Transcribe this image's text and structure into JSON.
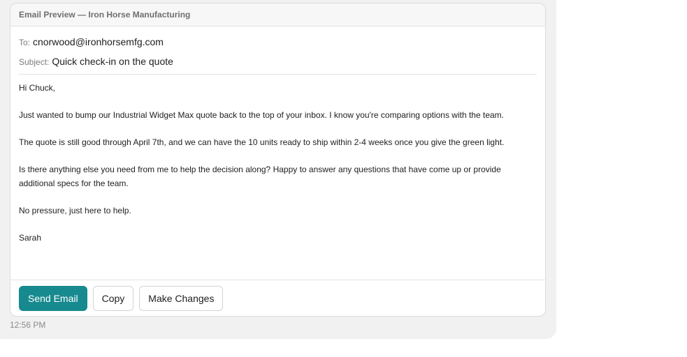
{
  "card": {
    "title": "Email Preview — Iron Horse Manufacturing"
  },
  "email": {
    "to_label": "To:",
    "to": "cnorwood@ironhorsemfg.com",
    "subject_label": "Subject:",
    "subject": "Quick check-in on the quote",
    "paragraphs": [
      "Hi Chuck,",
      "Just wanted to bump our Industrial Widget Max quote back to the top of your inbox. I know you're comparing options with the team.",
      "The quote is still good through April 7th, and we can have the 10 units ready to ship within 2-4 weeks once you give the green light.",
      "Is there anything else you need from me to help the decision along? Happy to answer any questions that have come up or provide additional specs for the team.",
      "No pressure, just here to help.",
      "Sarah"
    ]
  },
  "actions": {
    "send": "Send Email",
    "copy": "Copy",
    "changes": "Make Changes"
  },
  "message": {
    "timestamp": "12:56 PM"
  },
  "colors": {
    "accent": "#178a8f",
    "bubble_bg": "#f1f1f1"
  }
}
